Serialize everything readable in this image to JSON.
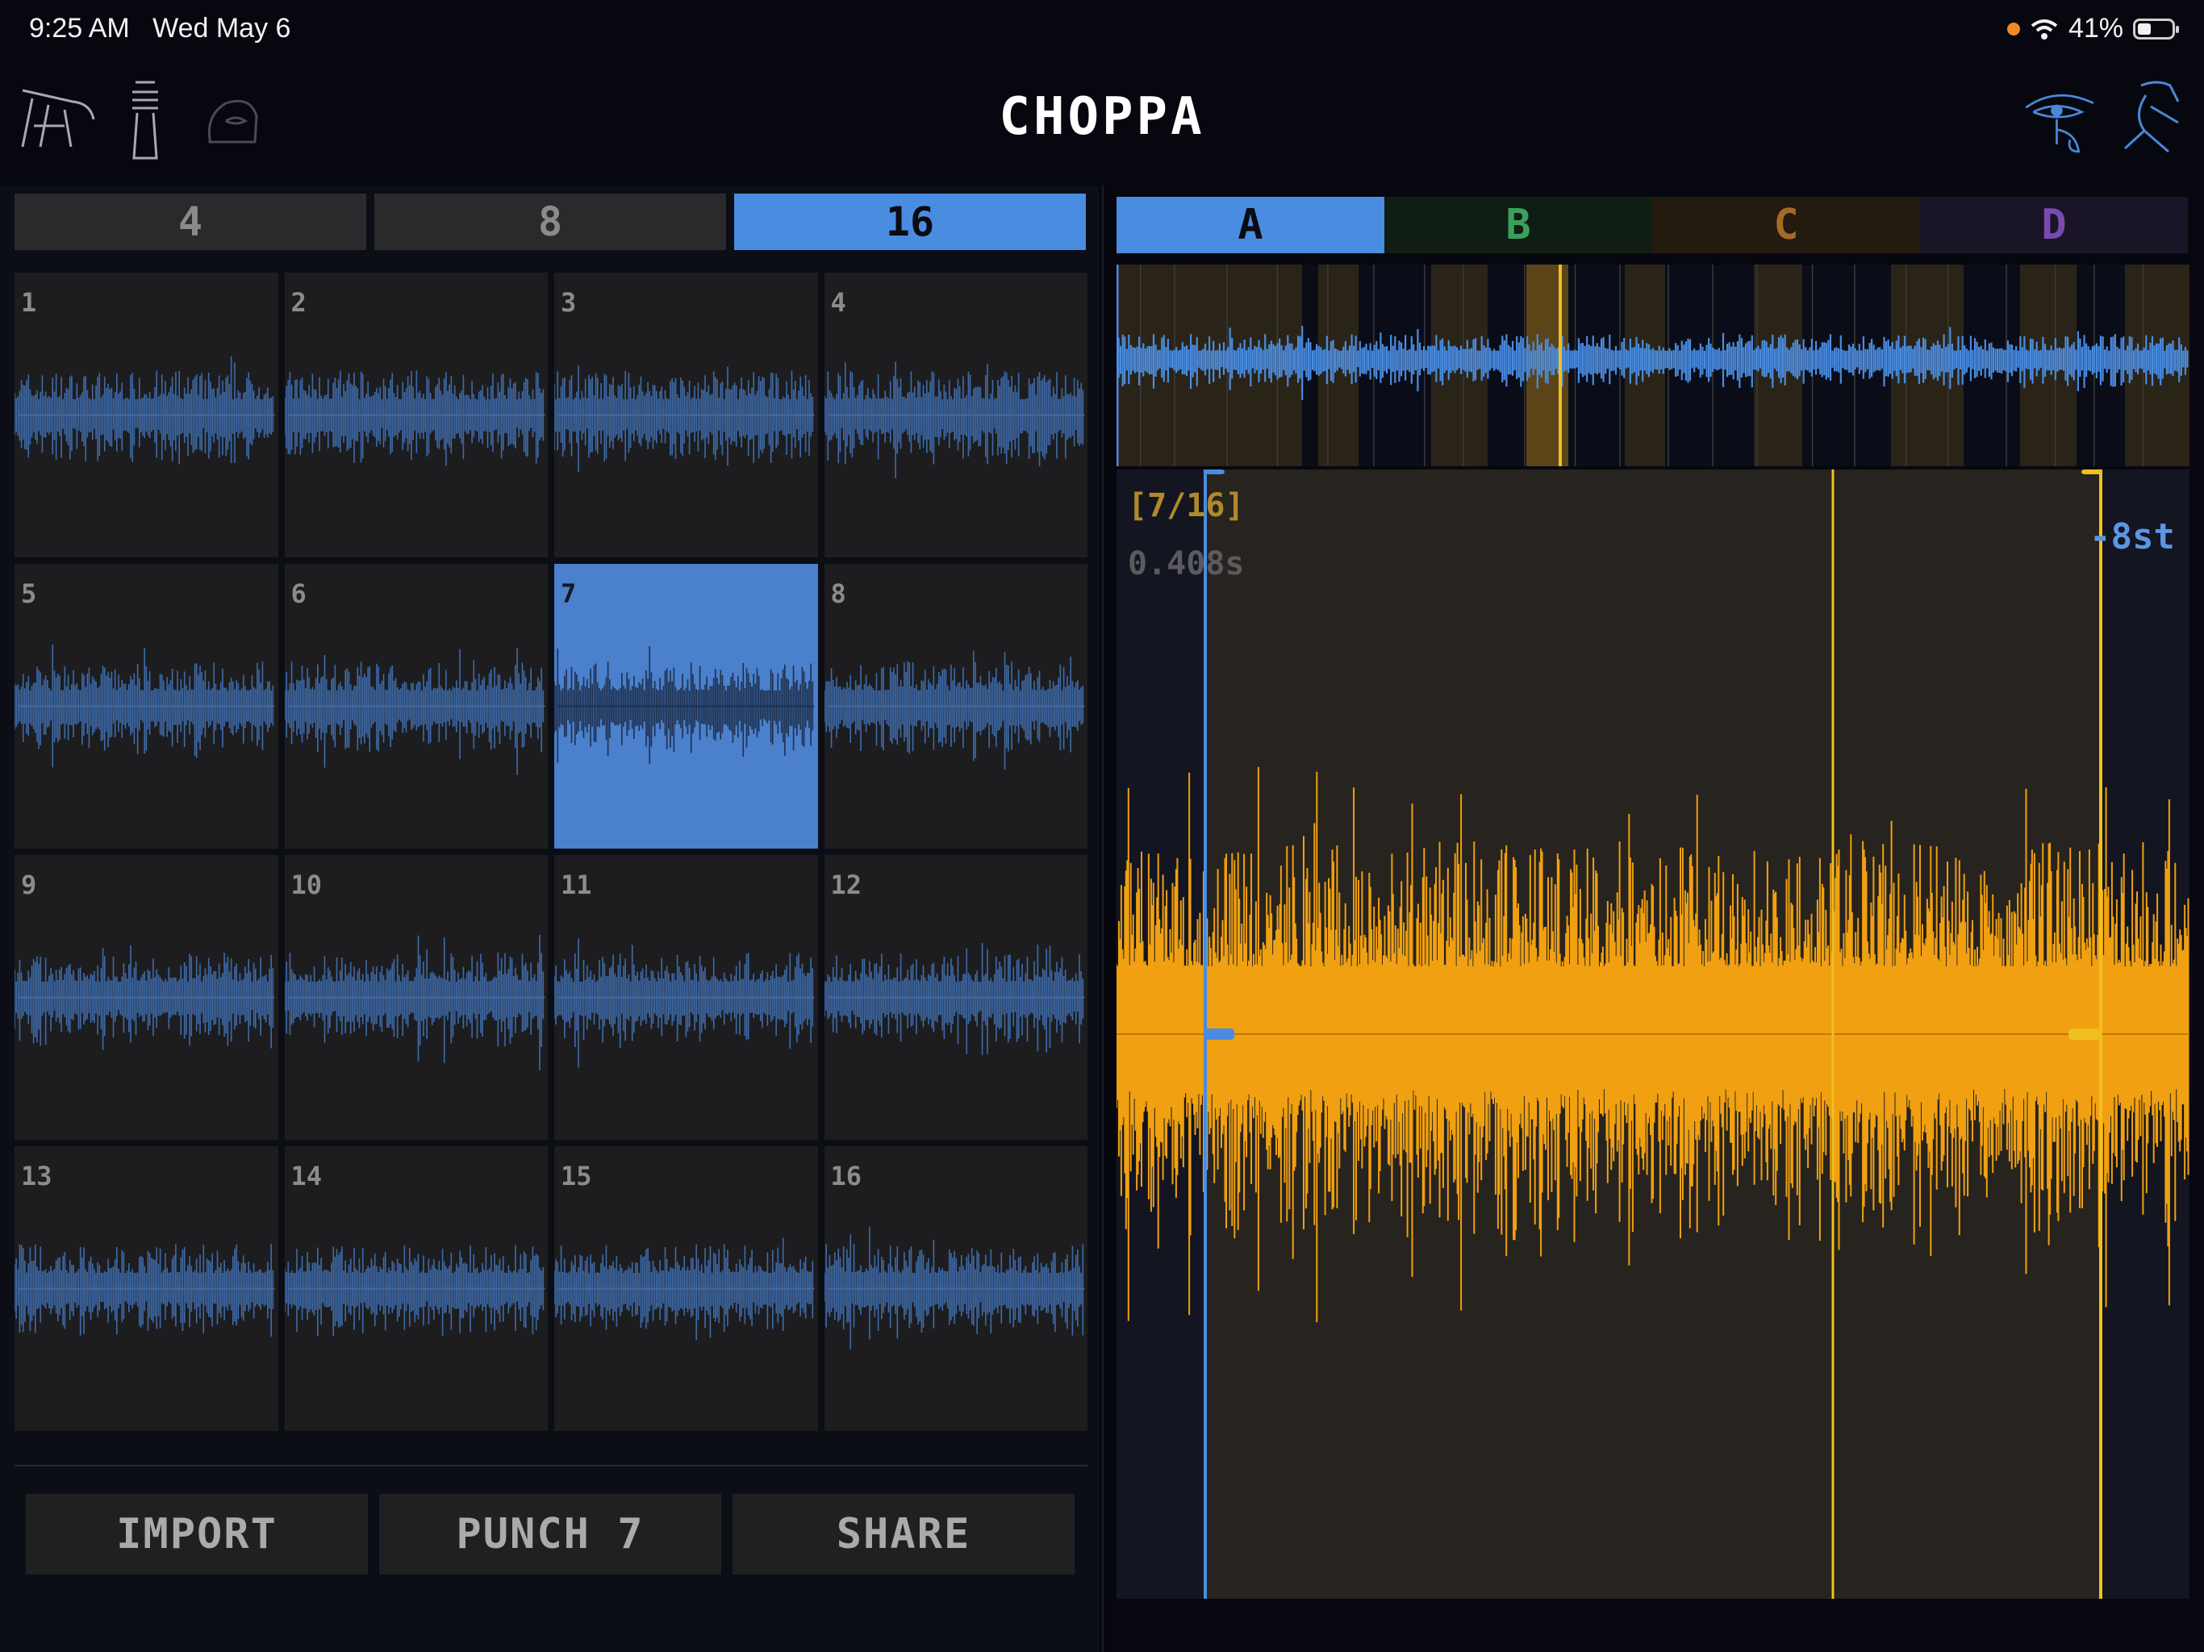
{
  "status_bar": {
    "time": "9:25 AM",
    "date": "Wed May 6",
    "battery": "41%",
    "icons": [
      "orange-dot-indicator",
      "wifi-icon",
      "battery-icon"
    ]
  },
  "header": {
    "title": "CHOPPA",
    "left_icons": [
      "tripod-tool-icon",
      "djed-pillar-icon",
      "hidden-face-icon"
    ],
    "right_icons": [
      "eye-of-horus-icon",
      "ibis-figure-icon"
    ],
    "accent": "#4a8ce0"
  },
  "slice_modes": {
    "options": [
      "4",
      "8",
      "16"
    ],
    "selected": "16"
  },
  "pads": {
    "labels": [
      "1",
      "2",
      "3",
      "4",
      "5",
      "6",
      "7",
      "8",
      "9",
      "10",
      "11",
      "12",
      "13",
      "14",
      "15",
      "16"
    ],
    "selected": "7",
    "colors": {
      "pad": "#1d1d1f",
      "selected": "#4a80cc",
      "wave": "#3e6aa8"
    }
  },
  "actions": {
    "import": "IMPORT",
    "punch": "PUNCH 7",
    "share": "SHARE"
  },
  "banks": {
    "tabs": [
      {
        "label": "A",
        "bg": "#4a8ce0",
        "fg": "#0b0b12"
      },
      {
        "label": "B",
        "bg": "#101d15",
        "fg": "#3aa05a"
      },
      {
        "label": "C",
        "bg": "#231a10",
        "fg": "#a56a2a"
      },
      {
        "label": "D",
        "bg": "#1a1526",
        "fg": "#7a4ab0"
      }
    ],
    "selected": "A"
  },
  "editor": {
    "slice_label": "[7/16]",
    "duration": "0.408s",
    "pitch": "-8st",
    "wave_color": "#f0a010",
    "region_color": "#27231e"
  }
}
